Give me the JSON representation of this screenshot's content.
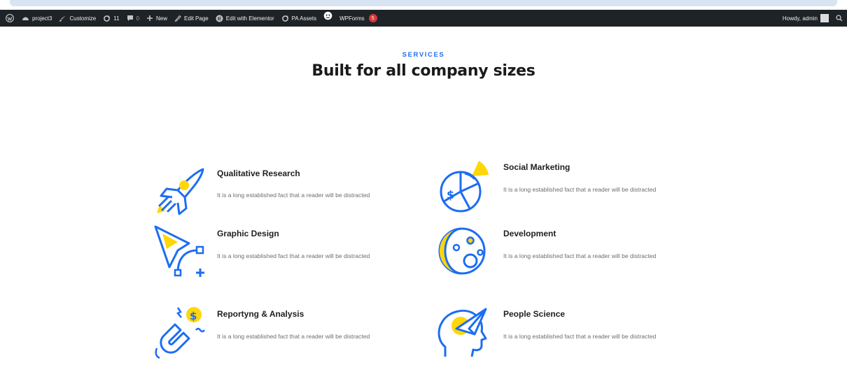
{
  "admin_bar": {
    "site_name": "project3",
    "customize": "Customize",
    "updates_count": "11",
    "comments_count": "0",
    "new_label": "New",
    "edit_page": "Edit Page",
    "edit_elementor": "Edit with Elementor",
    "pa_assets": "PA Assets",
    "wpforms": "WPForms",
    "wpforms_badge": "5",
    "howdy": "Howdy, admin"
  },
  "section": {
    "eyebrow": "SERVICES",
    "title": "Built for all company sizes"
  },
  "services": [
    {
      "title": "Qualitative Research",
      "text": "It is a long established fact that a reader will be distracted",
      "icon": "rocket-icon"
    },
    {
      "title": "Social Marketing",
      "text": "It is a long established fact that a reader will be distracted",
      "icon": "pie-chart-icon"
    },
    {
      "title": "Graphic Design",
      "text": "It is a long established fact that a reader will be distracted",
      "icon": "vector-pen-icon"
    },
    {
      "title": "Development",
      "text": "It is a long established fact that a reader will be distracted",
      "icon": "moon-icon"
    },
    {
      "title": "Reportyng & Analysis",
      "text": "It is a long established fact that a reader will be distracted",
      "icon": "magnet-dollar-icon"
    },
    {
      "title": "People Science",
      "text": "It is a long established fact that a reader will be distracted",
      "icon": "head-plane-icon"
    }
  ],
  "colors": {
    "accent_blue": "#1d6df2",
    "accent_yellow": "#ffd60a",
    "admin_bar_bg": "#1d2327"
  }
}
